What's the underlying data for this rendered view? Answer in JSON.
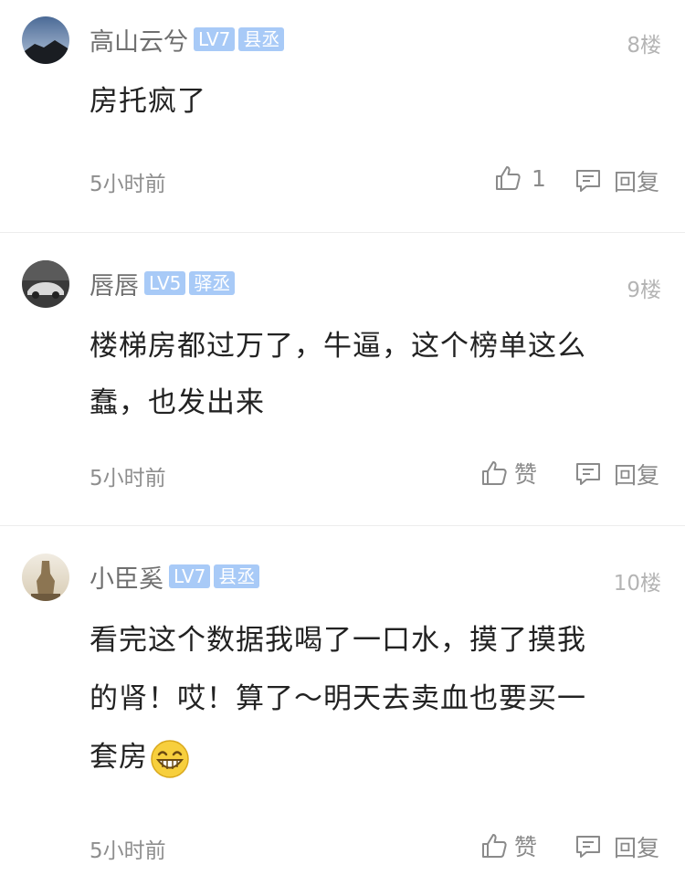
{
  "colors": {
    "badge_bg": "#a8caf7",
    "username": "#6f6f6f",
    "content": "#222222",
    "meta": "#8e8e8e",
    "floor": "#b4b4b4"
  },
  "comments": [
    {
      "username": "高山云兮",
      "level": "LV7",
      "title": "县丞",
      "floor": "8楼",
      "content": "房托疯了",
      "time": "5小时前",
      "like_label": "1",
      "reply_label": "回复",
      "avatar": "mountain-avatar"
    },
    {
      "username": "唇唇",
      "level": "LV5",
      "title": "驿丞",
      "floor": "9楼",
      "content_lines": [
        "楼梯房都过万了，牛逼，这个榜单这么",
        "蠢，也发出来"
      ],
      "time": "5小时前",
      "like_label": "赞",
      "reply_label": "回复",
      "avatar": "car-avatar"
    },
    {
      "username": "小臣奚",
      "level": "LV7",
      "title": "县丞",
      "floor": "10楼",
      "content_lines": [
        "看完这个数据我喝了一口水，摸了摸我",
        "的肾！哎！算了～明天去卖血也要买一",
        "套房"
      ],
      "emoji": "grinning-emoji",
      "time": "5小时前",
      "like_label": "赞",
      "reply_label": "回复",
      "avatar": "statue-avatar"
    }
  ]
}
